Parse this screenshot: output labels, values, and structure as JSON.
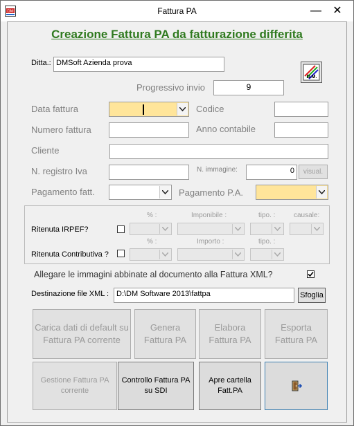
{
  "window": {
    "title": "Fattura PA",
    "minimize": "—",
    "close": "✕"
  },
  "heading": "Creazione Fattura PA da fatturazione differita",
  "ditta": {
    "label": "Ditta.:",
    "value": "DMSoft Azienda prova"
  },
  "logo_text": "D.M.",
  "progressivo": {
    "label": "Progressivo invio",
    "value": "9"
  },
  "fields": {
    "data_fattura": "Data fattura",
    "codice": "Codice",
    "numero_fattura": "Numero fattura",
    "anno_contabile": "Anno contabile",
    "cliente": "Cliente",
    "n_registro_iva": "N. registro Iva",
    "n_immagine": "N. immagine:",
    "n_immagine_value": "0",
    "visual": "visual.",
    "pagamento_fatt": "Pagamento fatt.",
    "pagamento_pa": "Pagamento P.A."
  },
  "ritenute": {
    "irpef_label": "Ritenuta  IRPEF?",
    "contributiva_label": "Ritenuta Contributiva ?",
    "perc": "% :",
    "imponibile": "Imponibile :",
    "importo": "Importo :",
    "tipo": "tipo. :",
    "causale": "causale:"
  },
  "allegare": "Allegare le immagini abbinate al documento alla Fattura XML?",
  "destinazione": {
    "label": "Destinazione file XML :",
    "value": "D:\\DM Software 2013\\fattpa",
    "browse": "Sfoglia"
  },
  "buttons": {
    "carica": "Carica dati di default su  Fattura PA corrente",
    "genera": "Genera Fattura PA",
    "elabora": "Elabora Fattura PA",
    "esporta": "Esporta Fattura PA",
    "gestione": "Gestione Fattura PA corrente",
    "controllo": "Controllo Fattura PA su SDI",
    "apre": "Apre cartella Fatt.PA"
  },
  "icons": {
    "app": "dm-app-icon",
    "logo": "dm-logo-icon",
    "exit": "exit-door-icon",
    "dropdown": "chevron-down-icon",
    "check": "check-icon"
  }
}
